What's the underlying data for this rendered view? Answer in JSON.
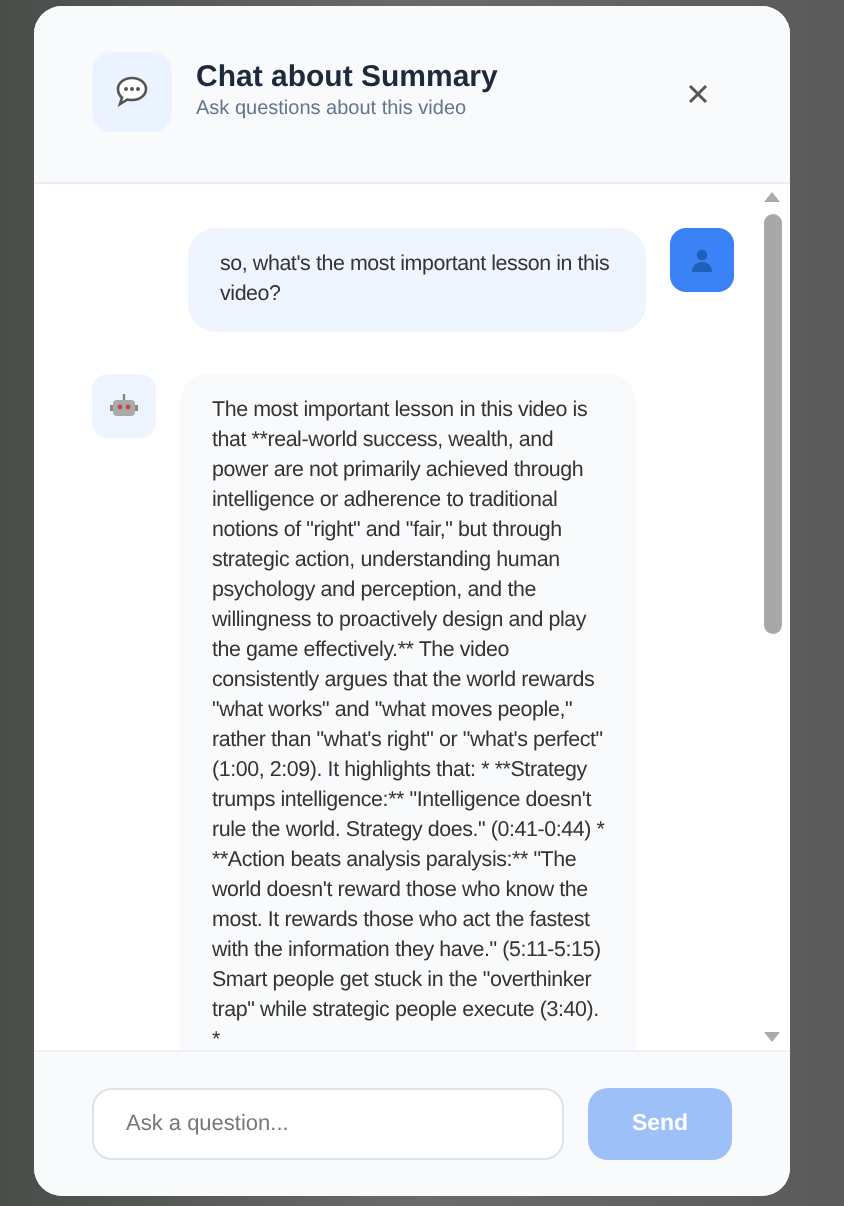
{
  "dialog": {
    "title": "Chat about Summary",
    "subtitle": "Ask questions about this video"
  },
  "messages": [
    {
      "kind": "user",
      "text": "so, what's the most important lesson in this video?"
    },
    {
      "kind": "assistant",
      "text": "The most important lesson in this video is that **real-world success, wealth, and power are not primarily achieved through intelligence or adherence to traditional notions of \"right\" and \"fair,\" but through strategic action, understanding human psychology and perception, and the willingness to proactively design and play the game effectively.** The video consistently argues that the world rewards \"what works\" and \"what moves people,\" rather than \"what's right\" or \"what's perfect\" (1:00, 2:09). It highlights that: * **Strategy trumps intelligence:** \"Intelligence doesn't rule the world. Strategy does.\" (0:41-0:44) * **Action beats analysis paralysis:** \"The world doesn't reward those who know the most. It rewards those who act the fastest with the information they have.\" (5:11-5:15) Smart people get stuck in the \"overthinker trap\" while strategic people execute (3:40). *"
    }
  ],
  "composer": {
    "placeholder": "Ask a question...",
    "send_label": "Send",
    "send_disabled": true
  }
}
